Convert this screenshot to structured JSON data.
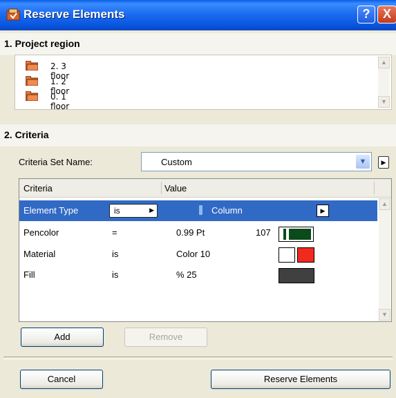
{
  "window": {
    "title": "Reserve Elements",
    "help_label": "?",
    "close_label": "X"
  },
  "sections": {
    "region_title": "1. Project region",
    "criteria_title": "2. Criteria"
  },
  "region_items": [
    {
      "label": "2. 3 floor"
    },
    {
      "label": "1. 2 floor"
    },
    {
      "label": "0. 1 floor"
    }
  ],
  "criteria_set": {
    "label": "Criteria Set Name:",
    "value": "Custom"
  },
  "table": {
    "headers": {
      "criteria": "Criteria",
      "value": "Value"
    },
    "rows": [
      {
        "criteria": "Element Type",
        "operator": "is",
        "value": "Column",
        "selected": true
      },
      {
        "criteria": "Pencolor",
        "operator": "=",
        "value": "0.99 Pt",
        "extra": "107"
      },
      {
        "criteria": "Material",
        "operator": "is",
        "value": "Color 10"
      },
      {
        "criteria": "Fill",
        "operator": "is",
        "value": "% 25"
      }
    ]
  },
  "buttons": {
    "add": "Add",
    "remove": "Remove",
    "cancel": "Cancel",
    "reserve": "Reserve Elements"
  },
  "colors": {
    "title_bar": "#0A5FE8",
    "selection": "#316AC5",
    "folder": "#E0743B",
    "pen_color": "#0B4A1B",
    "material_color": "#F02A1E"
  },
  "icons": {
    "app": "reserve-app-icon",
    "folder": "folder-icon",
    "column": "column-icon"
  }
}
